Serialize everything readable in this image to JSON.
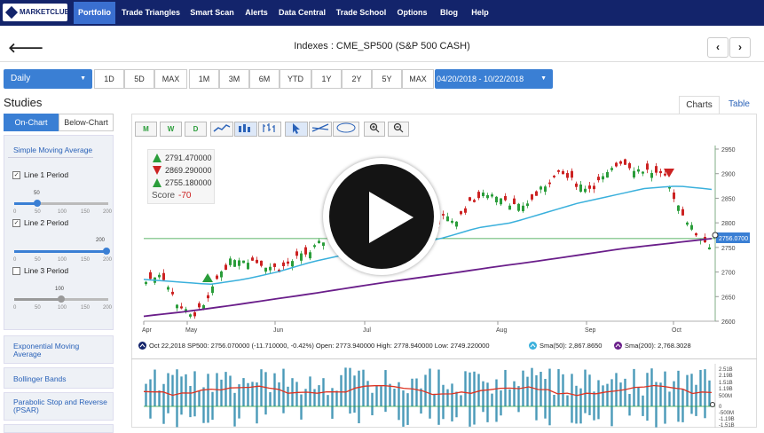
{
  "nav": {
    "logo": "MARKETCLUB",
    "items": [
      {
        "label": "Portfolio",
        "active": true
      },
      {
        "label": "Trade Triangles"
      },
      {
        "label": "Smart Scan"
      },
      {
        "label": "Alerts"
      },
      {
        "label": "Data Central"
      },
      {
        "label": "Trade School"
      },
      {
        "label": "Options"
      },
      {
        "label": "Blog"
      },
      {
        "label": "Help"
      }
    ]
  },
  "header": {
    "title": "Indexes : CME_SP500 (S&P 500 CASH)",
    "back_icon": "arrow-left-icon",
    "prev_icon": "chevron-left-icon",
    "next_icon": "chevron-right-icon"
  },
  "controls": {
    "interval": "Daily",
    "ranges_a": [
      "1D",
      "5D",
      "MAX"
    ],
    "ranges_b": [
      "1M",
      "3M",
      "6M",
      "YTD",
      "1Y",
      "2Y",
      "5Y",
      "MAX"
    ],
    "date_range": "04/20/2018 - 10/22/2018"
  },
  "studies": {
    "heading": "Studies",
    "tabs": [
      "On-Chart",
      "Below-Chart"
    ],
    "sma": {
      "title": "Simple Moving Average",
      "lines": [
        {
          "label": "Line 1 Period",
          "checked": true,
          "value": "50",
          "fraction": 0.25
        },
        {
          "label": "Line 2 Period",
          "checked": true,
          "value": "200",
          "fraction": 1.0
        },
        {
          "label": "Line 3 Period",
          "checked": false,
          "value": "100",
          "fraction": 0.5
        }
      ],
      "ticks": [
        "0",
        "50",
        "100",
        "150",
        "200"
      ]
    },
    "others": [
      "Exponential Moving Average",
      "Bollinger Bands",
      "Parabolic Stop and Reverse (PSAR)"
    ]
  },
  "chart_tabs": [
    "Charts",
    "Table"
  ],
  "toolbar": {
    "icons": [
      "monthly-triangle-icon",
      "weekly-triangle-icon",
      "daily-triangle-icon",
      "line-chart-icon",
      "bar-chart-icon",
      "ohlc-chart-icon",
      "pointer-icon",
      "trendline-icon",
      "fibonacci-icon",
      "zoom-in-icon",
      "zoom-out-icon"
    ],
    "letters": [
      "M",
      "W",
      "D"
    ]
  },
  "signals": {
    "values": [
      "2791.470000",
      "2869.290000",
      "2755.180000"
    ],
    "score_label": "Score",
    "score_value": "-70"
  },
  "chart_data": {
    "type": "candlestick",
    "x_labels": [
      "Apr",
      "May",
      "Jun",
      "Jul",
      "Aug",
      "Sep",
      "Oct"
    ],
    "y_ticks": [
      "2950",
      "2900",
      "2850",
      "2800",
      "2750",
      "2700",
      "2650",
      "2600"
    ],
    "ylim": [
      2600,
      2950
    ],
    "last_price_label": "2756.0700",
    "price_anchors": [
      2680,
      2700,
      2640,
      2610,
      2630,
      2700,
      2730,
      2725,
      2715,
      2705,
      2725,
      2740,
      2765,
      2785,
      2775,
      2760,
      2720,
      2715,
      2740,
      2780,
      2810,
      2805,
      2845,
      2860,
      2855,
      2830,
      2845,
      2880,
      2900,
      2880,
      2870,
      2895,
      2925,
      2910,
      2905,
      2890,
      2830,
      2780,
      2755
    ],
    "sma50_anchors": [
      2685,
      2680,
      2675,
      2685,
      2700,
      2720,
      2735,
      2745,
      2755,
      2770,
      2790,
      2800,
      2820,
      2840,
      2855,
      2870,
      2875,
      2868
    ],
    "sma200_anchors": [
      2610,
      2620,
      2632,
      2645,
      2658,
      2672,
      2685,
      2697,
      2710,
      2722,
      2735,
      2748,
      2758,
      2768
    ],
    "reference_level": 2768,
    "legend": {
      "quote": "Oct 22,2018 SP500: 2756.070000 (-11.710000, -0.42%) Open: 2773.940000 High: 2778.940000 Low: 2749.220000",
      "sma50": "Sma(50): 2,867.8650",
      "sma200": "Sma(200): 2,768.3028"
    },
    "volume_ticks": [
      "2.51B",
      "2.19B",
      "1.51B",
      "1.19B",
      "500M",
      "0",
      "-500M",
      "-1.19B",
      "-1.51B"
    ],
    "colors": {
      "up": "#2a9d3a",
      "down": "#cc2222",
      "sma50": "#3ab0dc",
      "sma200": "#6a1e8a",
      "volume": "#4a9ab8",
      "oscillator": "#dd3322"
    }
  }
}
